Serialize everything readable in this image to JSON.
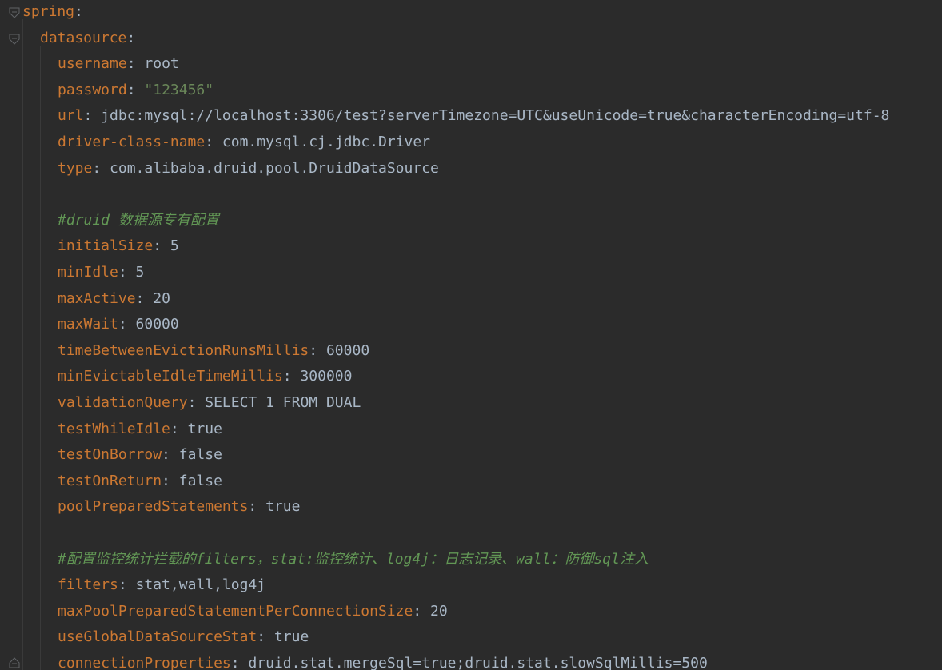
{
  "editor": {
    "lines": [
      {
        "type": "kv",
        "key": "spring",
        "sep": ":",
        "value": ""
      },
      {
        "type": "kv",
        "key": "datasource",
        "sep": ":",
        "value": ""
      },
      {
        "type": "kv",
        "key": "username",
        "sep": ": ",
        "value": "root"
      },
      {
        "type": "kv",
        "key": "password",
        "sep": ": ",
        "value": "\"123456\"",
        "string": true
      },
      {
        "type": "kv",
        "key": "url",
        "sep": ": ",
        "value": "jdbc:mysql://localhost:3306/test?serverTimezone=UTC&useUnicode=true&characterEncoding=utf-8"
      },
      {
        "type": "kv",
        "key": "driver-class-name",
        "sep": ": ",
        "value": "com.mysql.cj.jdbc.Driver"
      },
      {
        "type": "kv",
        "key": "type",
        "sep": ": ",
        "value": "com.alibaba.druid.pool.DruidDataSource"
      },
      {
        "type": "blank"
      },
      {
        "type": "comment",
        "text": "#druid 数据源专有配置"
      },
      {
        "type": "kv",
        "key": "initialSize",
        "sep": ": ",
        "value": "5"
      },
      {
        "type": "kv",
        "key": "minIdle",
        "sep": ": ",
        "value": "5"
      },
      {
        "type": "kv",
        "key": "maxActive",
        "sep": ": ",
        "value": "20"
      },
      {
        "type": "kv",
        "key": "maxWait",
        "sep": ": ",
        "value": "60000"
      },
      {
        "type": "kv",
        "key": "timeBetweenEvictionRunsMillis",
        "sep": ": ",
        "value": "60000"
      },
      {
        "type": "kv",
        "key": "minEvictableIdleTimeMillis",
        "sep": ": ",
        "value": "300000"
      },
      {
        "type": "kv",
        "key": "validationQuery",
        "sep": ": ",
        "value": "SELECT 1 FROM DUAL"
      },
      {
        "type": "kv",
        "key": "testWhileIdle",
        "sep": ": ",
        "value": "true"
      },
      {
        "type": "kv",
        "key": "testOnBorrow",
        "sep": ": ",
        "value": "false"
      },
      {
        "type": "kv",
        "key": "testOnReturn",
        "sep": ": ",
        "value": "false"
      },
      {
        "type": "kv",
        "key": "poolPreparedStatements",
        "sep": ": ",
        "value": "true"
      },
      {
        "type": "blank"
      },
      {
        "type": "comment",
        "text": "#配置监控统计拦截的filters，stat:监控统计、log4j：日志记录、wall：防御sql注入"
      },
      {
        "type": "kv",
        "key": "filters",
        "sep": ": ",
        "value": "stat,wall,log4j"
      },
      {
        "type": "kv",
        "key": "maxPoolPreparedStatementPerConnectionSize",
        "sep": ": ",
        "value": "20"
      },
      {
        "type": "kv",
        "key": "useGlobalDataSourceStat",
        "sep": ": ",
        "value": "true"
      },
      {
        "type": "kv",
        "key": "connectionProperties",
        "sep": ": ",
        "value": "druid.stat.mergeSql=true;druid.stat.slowSqlMillis=500"
      }
    ]
  },
  "colors": {
    "background": "#2b2b2b",
    "key": "#cc7832",
    "value": "#a9b7c6",
    "string": "#6a8759",
    "comment": "#629755"
  },
  "icons": {
    "fold_marker": "fold-icon"
  }
}
